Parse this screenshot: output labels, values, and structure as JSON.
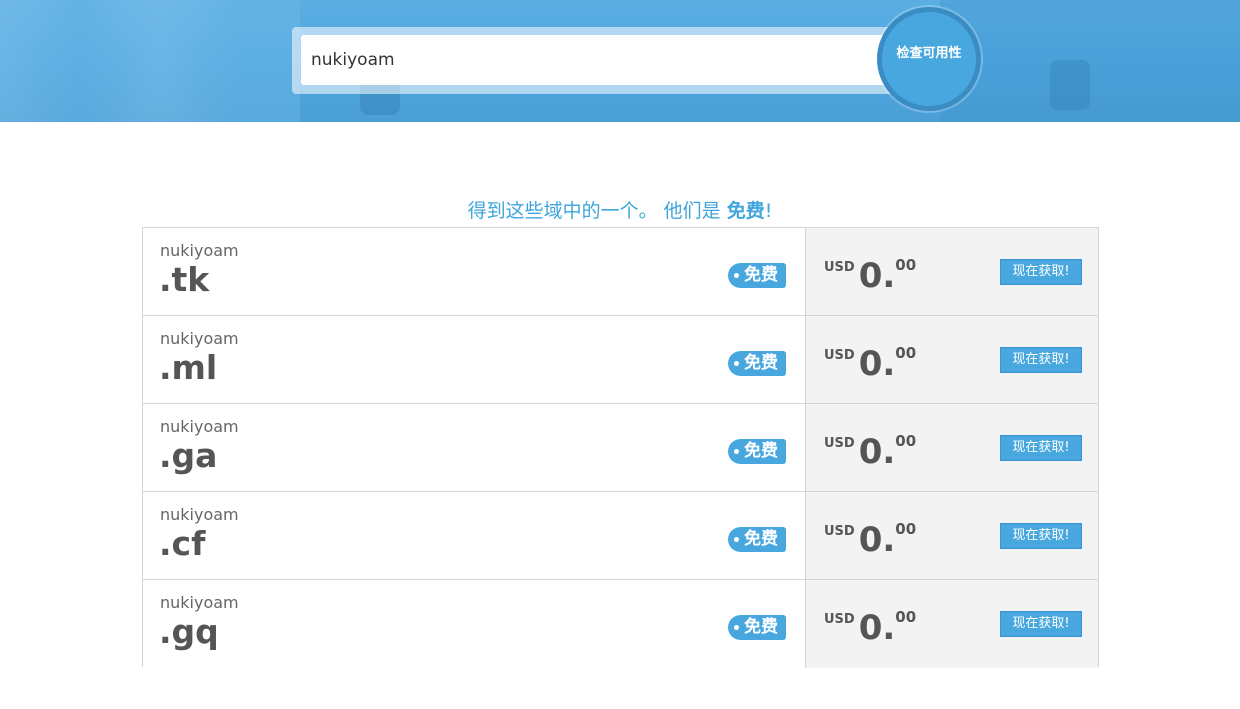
{
  "search": {
    "value": "nukiyoam",
    "button_label": "检查可用性"
  },
  "heading": {
    "prefix": "得到这些域中的一个。 他们是 ",
    "emphasis": "免费",
    "suffix": "!"
  },
  "domains": [
    {
      "name": "nukiyoam",
      "tld": ".tk",
      "badge": "免费",
      "currency": "USD",
      "price_whole": "0.",
      "price_decimal": "00",
      "button": "现在获取!"
    },
    {
      "name": "nukiyoam",
      "tld": ".ml",
      "badge": "免费",
      "currency": "USD",
      "price_whole": "0.",
      "price_decimal": "00",
      "button": "现在获取!"
    },
    {
      "name": "nukiyoam",
      "tld": ".ga",
      "badge": "免费",
      "currency": "USD",
      "price_whole": "0.",
      "price_decimal": "00",
      "button": "现在获取!"
    },
    {
      "name": "nukiyoam",
      "tld": ".cf",
      "badge": "免费",
      "currency": "USD",
      "price_whole": "0.",
      "price_decimal": "00",
      "button": "现在获取!"
    },
    {
      "name": "nukiyoam",
      "tld": ".gq",
      "badge": "免费",
      "currency": "USD",
      "price_whole": "0.",
      "price_decimal": "00",
      "button": "现在获取!"
    }
  ],
  "colors": {
    "accent": "#49a7df",
    "heading": "#3fa5dc",
    "price_panel": "#f3f3f3"
  }
}
